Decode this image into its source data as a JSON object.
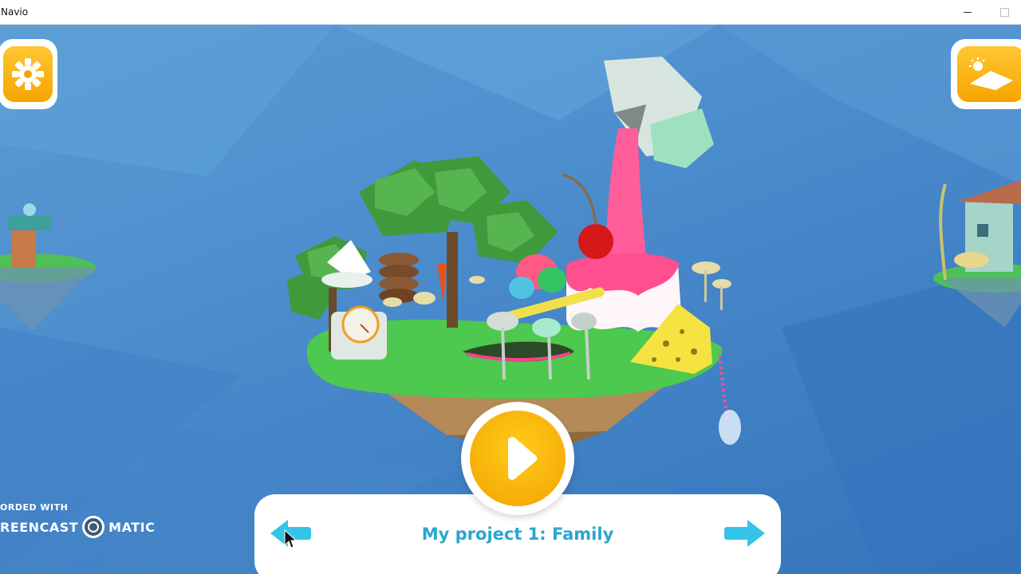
{
  "window": {
    "title": "Navio"
  },
  "toolbar": {
    "settings_icon": "gear-icon",
    "landscape_icon": "landscape-icon"
  },
  "project": {
    "title": "My project 1: Family",
    "prev_icon": "arrow-left-icon",
    "next_icon": "arrow-right-icon",
    "play_icon": "play-icon"
  },
  "watermark": {
    "line1": "ORDED WITH",
    "line2a": "REENCAST",
    "line2b": "MATIC"
  },
  "colors": {
    "accent_yellow": "#f7a400",
    "accent_cyan": "#2aa6cf",
    "sky": "#4e8fcf"
  }
}
